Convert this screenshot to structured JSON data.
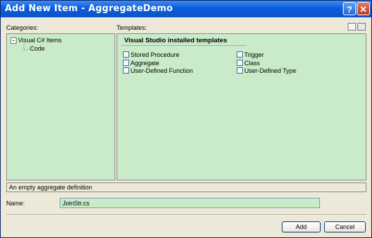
{
  "window": {
    "title": "Add New Item - AggregateDemo",
    "help_glyph": "?",
    "close_glyph": "✕"
  },
  "categories": {
    "label": "Categories:",
    "expander_glyph": "−",
    "tree": [
      {
        "label": "Visual C# Items"
      },
      {
        "label": "Code"
      }
    ]
  },
  "templates": {
    "label": "Templates:",
    "heading": "Visual Studio installed templates",
    "items": [
      {
        "label": "Stored Procedure",
        "icon": "stored-procedure-icon"
      },
      {
        "label": "Aggregate",
        "icon": "aggregate-icon"
      },
      {
        "label": "User-Defined Function",
        "icon": "user-defined-function-icon"
      },
      {
        "label": "Trigger",
        "icon": "trigger-icon"
      },
      {
        "label": "Class",
        "icon": "class-icon"
      },
      {
        "label": "User-Defined Type",
        "icon": "user-defined-type-icon"
      }
    ]
  },
  "description": "An empty aggregate definition",
  "name_field": {
    "label": "Name:",
    "value": "JoinStr.cs"
  },
  "buttons": {
    "add": "Add",
    "cancel": "Cancel"
  },
  "colors": {
    "panel": "#c9ebc9",
    "titlebar": "#0a5ddc",
    "dialog": "#ece9d8"
  }
}
